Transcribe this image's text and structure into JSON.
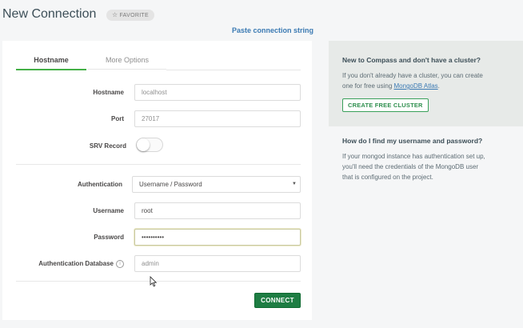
{
  "header": {
    "title": "New Connection",
    "favorite_label": "FAVORITE",
    "paste_link": "Paste connection string"
  },
  "tabs": [
    {
      "label": "Hostname",
      "active": true
    },
    {
      "label": "More Options",
      "active": false
    }
  ],
  "form": {
    "hostname": {
      "label": "Hostname",
      "value": "localhost"
    },
    "port": {
      "label": "Port",
      "value": "27017"
    },
    "srv": {
      "label": "SRV Record",
      "enabled": false
    },
    "authentication": {
      "label": "Authentication",
      "value": "Username / Password"
    },
    "username": {
      "label": "Username",
      "value": "root"
    },
    "password": {
      "label": "Password",
      "value": "••••••••••"
    },
    "auth_db": {
      "label": "Authentication Database",
      "placeholder": "admin"
    },
    "connect_label": "CONNECT"
  },
  "info": {
    "cluster_heading": "New to Compass and don't have a cluster?",
    "cluster_text_1": "If you don't already have a cluster, you can create",
    "cluster_text_2": "one for free using",
    "atlas_link": "MongoDB Atlas",
    "cluster_text_3": ".",
    "cluster_button": "CREATE FREE CLUSTER",
    "creds_heading": "How do I find my username and password?",
    "creds_lines": [
      "If your mongod instance has authentication set up,",
      "you'll need the credentials of the MongoDB user",
      "that is configured on the project."
    ]
  },
  "colors": {
    "accent_green": "#43b047",
    "connect_button": "#1e7d43",
    "link_blue": "#3b7ab3"
  },
  "icons": [
    "star-icon",
    "info-icon",
    "caret-down-icon",
    "mouse-cursor-icon"
  ]
}
